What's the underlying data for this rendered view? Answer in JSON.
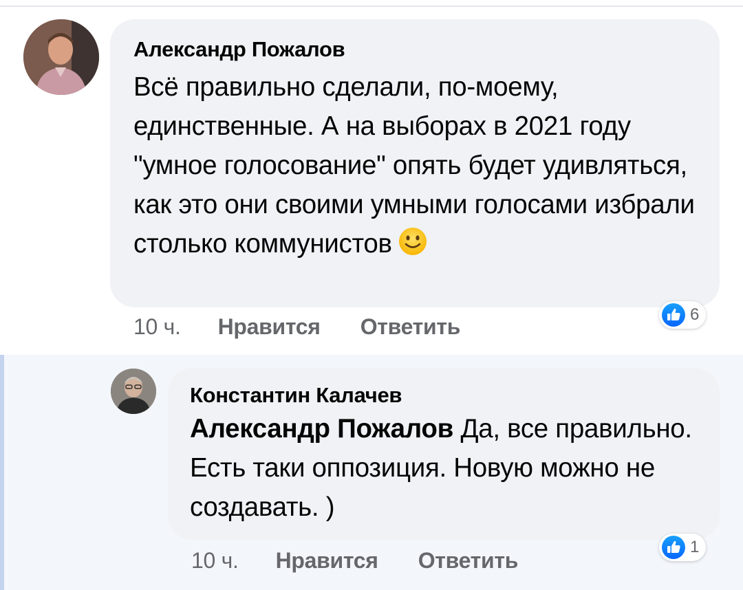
{
  "comments": [
    {
      "author": "Александр Пожалов",
      "text": "Всё правильно сделали, по-моему, единственные. А на выборах в 2021 году \"умное голосование\" опять будет удивляться, как это они своими умными голосами избрали столько коммунистов",
      "emoji": "slightly-smiling-face-icon",
      "time": "10 ч.",
      "like_label": "Нравится",
      "reply_label": "Ответить",
      "reaction_count": "6"
    },
    {
      "author": "Константин Калачев",
      "mention": "Александр Пожалов",
      "text": "Да, все правильно. Есть таки оппозиция. Новую можно не создавать. )",
      "time": "10 ч.",
      "like_label": "Нравится",
      "reply_label": "Ответить",
      "reaction_count": "1"
    }
  ],
  "colors": {
    "bubble": "#f0f2f5",
    "meta_text": "#65676b",
    "like_blue": "#1877f2",
    "reply_background": "#f3f6fb",
    "thread_line": "#c4d4ef"
  }
}
